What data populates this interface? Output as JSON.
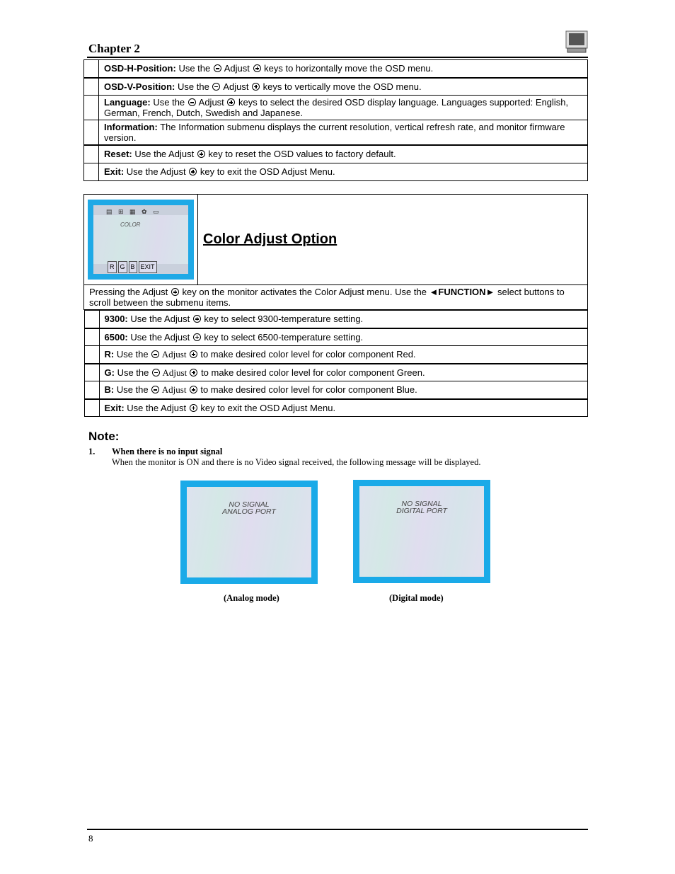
{
  "header": {
    "chapter": "Chapter 2",
    "icon": "monitor-icon"
  },
  "osd_table": [
    {
      "label": "OSD-H-Position:",
      "pre": " Use the ",
      "minus": true,
      "mid": " Adjust ",
      "plus": true,
      "post": " keys to horizontally move the OSD menu."
    },
    {
      "label": "OSD-V-Position:",
      "pre": " Use the ",
      "minus": true,
      "mid": " Adjust ",
      "plus": true,
      "post": " keys to vertically move the OSD menu."
    },
    {
      "label": "Language:",
      "pre": " Use the ",
      "minus": true,
      "mid": " Adjust ",
      "plus": true,
      "post": " keys to select the desired OSD display language.  Languages supported: English, German, French, Dutch, Swedish and Japanese."
    },
    {
      "label": "Information:",
      "pre": " The Information submenu displays the current resolution, vertical refresh rate, and monitor firmware version.",
      "minus": false,
      "mid": "",
      "plus": false,
      "post": ""
    },
    {
      "label": "Reset:",
      "pre": " Use the Adjust ",
      "minus": false,
      "mid": "",
      "plus": true,
      "post": " key to reset the OSD values to factory default."
    },
    {
      "label": "Exit:",
      "pre": " Use the Adjust ",
      "minus": false,
      "mid": "",
      "plus": true,
      "post": " key to exit the OSD Adjust Menu."
    }
  ],
  "color_section": {
    "title": "Color Adjust Option",
    "osd_screenshot": {
      "menu_title": "COLOR",
      "bottom_buttons": [
        "R",
        "G",
        "B",
        "EXIT"
      ]
    },
    "intro_pre": "Pressing the Adjust ",
    "intro_mid": " key on the monitor activates the Color Adjust menu.  Use the ",
    "intro_function": "◄FUNCTION►",
    "intro_post": " select buttons to scroll between the submenu items.",
    "rows": [
      {
        "label": "9300:",
        "pre": "  Use the Adjust ",
        "minus": false,
        "mid": "",
        "plus": true,
        "post": " key to select 9300-temperature setting."
      },
      {
        "label": "6500:",
        "pre": "  Use the Adjust ",
        "minus": false,
        "mid": "",
        "plus": true,
        "post": " key to select 6500-temperature setting."
      },
      {
        "label": "R:",
        "pre": "  Use the  ",
        "minus": true,
        "mid": " Adjust ",
        "plus": true,
        "post": " to make desired color level for color component Red."
      },
      {
        "label": "G:",
        "pre": "  Use the  ",
        "minus": true,
        "mid": " Adjust ",
        "plus": true,
        "post": " to make desired color level for color component Green."
      },
      {
        "label": "B:",
        "pre": "  Use the  ",
        "minus": true,
        "mid": " Adjust ",
        "plus": true,
        "post": " to make desired color level for color component Blue."
      },
      {
        "label": "Exit:",
        "pre": " Use the Adjust ",
        "minus": false,
        "mid": "",
        "plus": true,
        "post": " key to exit the OSD Adjust Menu."
      }
    ]
  },
  "note": {
    "heading": "Note:",
    "item_number": "1.",
    "item_title": "When there is no input signal",
    "item_text": "When the monitor is ON and there is no Video signal received, the following message will be displayed.",
    "screens": [
      {
        "line1": "NO SIGNAL",
        "line2": "ANALOG PORT",
        "caption": "(Analog mode)"
      },
      {
        "line1": "NO SIGNAL",
        "line2": "DIGITAL PORT",
        "caption": "(Digital mode)"
      }
    ]
  },
  "footer": {
    "page_number": "8"
  }
}
